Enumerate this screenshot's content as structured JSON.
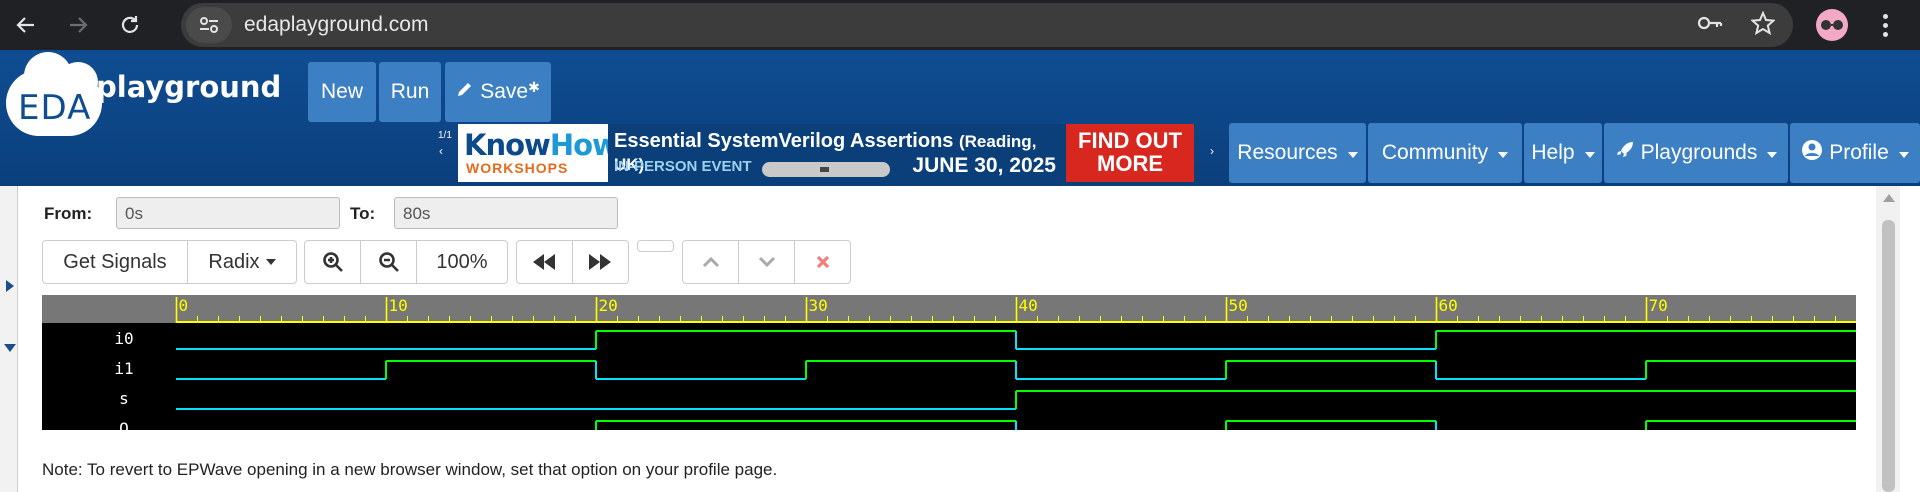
{
  "browser": {
    "url": "edaplayground.com",
    "icons": [
      "back-icon",
      "forward-icon",
      "reload-icon",
      "site-info-icon",
      "password-key-icon",
      "bookmark-star-icon",
      "profile-avatar-icon",
      "menu-kebab-icon"
    ]
  },
  "header": {
    "logo_eda": "EDA",
    "logo_playground": "playground",
    "buttons": {
      "new": "New",
      "run": "Run",
      "save": "Save"
    },
    "save_marker": "✱",
    "banner": {
      "counter": "1/1",
      "brand_know": "Know",
      "brand_how": "How",
      "brand_sub": "WORKSHOPS",
      "title": "Essential SystemVerilog Assertions",
      "title_small": "(Reading, UK)",
      "event": "IN-PERSON EVENT",
      "date": "JUNE 30, 2025",
      "cta": "FIND OUT MORE"
    },
    "menus": {
      "resources": "Resources",
      "community": "Community",
      "help": "Help",
      "playgrounds": "Playgrounds",
      "profile": "Profile"
    }
  },
  "waveform": {
    "from_label": "From:",
    "from_value": "0s",
    "to_label": "To:",
    "to_value": "80s",
    "get_signals": "Get Signals",
    "radix": "Radix",
    "zoom": "100%",
    "colors": {
      "rising_high": "#00ff00",
      "low": "#00e5ff",
      "ruler": "#ffff00",
      "ruler_bg": "#777777"
    },
    "timeline": {
      "start": 0,
      "end": 80,
      "major_ticks": [
        0,
        10,
        20,
        30,
        40,
        50,
        60,
        70
      ]
    },
    "signals": [
      {
        "name": "i0",
        "transitions": [
          [
            0,
            0
          ],
          [
            20,
            1
          ],
          [
            40,
            0
          ],
          [
            60,
            1
          ]
        ]
      },
      {
        "name": "i1",
        "transitions": [
          [
            0,
            0
          ],
          [
            10,
            1
          ],
          [
            20,
            0
          ],
          [
            30,
            1
          ],
          [
            40,
            0
          ],
          [
            50,
            1
          ],
          [
            60,
            0
          ],
          [
            70,
            1
          ]
        ]
      },
      {
        "name": "s",
        "transitions": [
          [
            0,
            0
          ],
          [
            40,
            1
          ]
        ]
      },
      {
        "name": "Q",
        "transitions": [
          [
            0,
            0
          ],
          [
            20,
            1
          ],
          [
            40,
            0
          ],
          [
            50,
            1
          ],
          [
            60,
            0
          ],
          [
            70,
            1
          ]
        ]
      }
    ]
  },
  "note": "Note: To revert to EPWave opening in a new browser window, set that option on your profile page."
}
